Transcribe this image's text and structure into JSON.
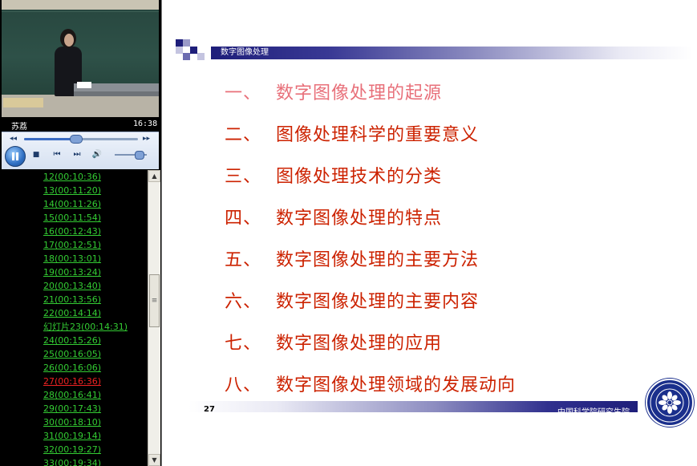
{
  "player": {
    "speaker": "苏荔",
    "time": "16:38",
    "seek_fraction": 0.45,
    "volume_fraction": 0.75
  },
  "playlist": [
    {
      "label": "12(00:10:36)",
      "color": "#33cc33"
    },
    {
      "label": "13(00:11:20)",
      "color": "#33cc33"
    },
    {
      "label": "14(00:11:26)",
      "color": "#33cc33"
    },
    {
      "label": "15(00:11:54)",
      "color": "#33cc33"
    },
    {
      "label": "16(00:12:43)",
      "color": "#33cc33"
    },
    {
      "label": "17(00:12:51)",
      "color": "#33cc33"
    },
    {
      "label": "18(00:13:01)",
      "color": "#33cc33"
    },
    {
      "label": "19(00:13:24)",
      "color": "#33cc33"
    },
    {
      "label": "20(00:13:40)",
      "color": "#33cc33"
    },
    {
      "label": "21(00:13:56)",
      "color": "#33cc33"
    },
    {
      "label": "22(00:14:14)",
      "color": "#33cc33"
    },
    {
      "label": "幻灯片23(00:14:31)",
      "color": "#33cc33"
    },
    {
      "label": "24(00:15:26)",
      "color": "#33cc33"
    },
    {
      "label": "25(00:16:05)",
      "color": "#33cc33"
    },
    {
      "label": "26(00:16:06)",
      "color": "#33cc33"
    },
    {
      "label": "27(00:16:36)",
      "color": "#ee2222"
    },
    {
      "label": "28(00:16:41)",
      "color": "#33cc33"
    },
    {
      "label": "29(00:17:43)",
      "color": "#33cc33"
    },
    {
      "label": "30(00:18:10)",
      "color": "#33cc33"
    },
    {
      "label": "31(00:19:14)",
      "color": "#33cc33"
    },
    {
      "label": "32(00:19:27)",
      "color": "#33cc33"
    },
    {
      "label": "33(00:19:34)",
      "color": "#33cc33"
    }
  ],
  "slide": {
    "title": "数字图像处理",
    "items": [
      {
        "num": "一、",
        "text": "数字图像处理的起源",
        "color": "#e8707a"
      },
      {
        "num": "二、",
        "text": "图像处理科学的重要意义",
        "color": "#cc2200"
      },
      {
        "num": "三、",
        "text": "图像处理技术的分类",
        "color": "#cc2200"
      },
      {
        "num": "四、",
        "text": "数字图像处理的特点",
        "color": "#cc2200"
      },
      {
        "num": "五、",
        "text": "数字图像处理的主要方法",
        "color": "#cc2200"
      },
      {
        "num": "六、",
        "text": "数字图像处理的主要内容",
        "color": "#cc2200"
      },
      {
        "num": "七、",
        "text": "数字图像处理的应用",
        "color": "#cc2200"
      },
      {
        "num": "八、",
        "text": "数字图像处理领域的发展动向",
        "color": "#cc2200"
      }
    ],
    "page_number": "27",
    "institution": "中国科学院研究生院"
  },
  "colors": {
    "accent_blue": "#1e1e7a",
    "playlist_default": "#33cc33",
    "playlist_current": "#ee2222",
    "toc_red": "#cc2200"
  }
}
